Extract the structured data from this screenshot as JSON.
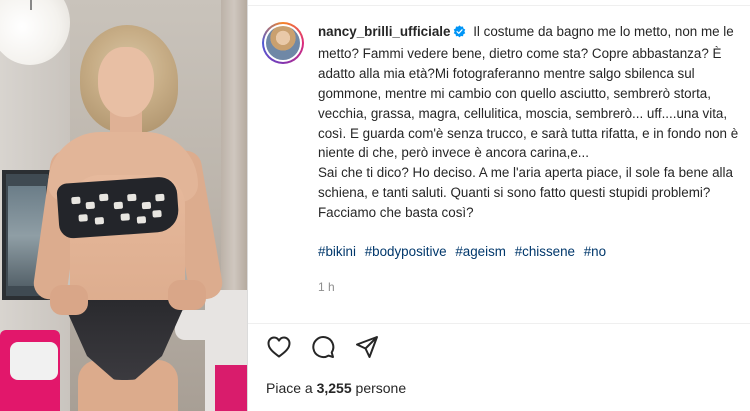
{
  "post": {
    "username": "nancy_brilli_ufficiale",
    "verified": true,
    "caption": "Il costume da bagno me lo metto, non me le metto? Fammi vedere bene, dietro come sta? Copre abbastanza? È adatto alla mia età?Mi fotograferanno mentre salgo sbilenca sul gommone, mentre mi cambio con quello asciutto, sembrerò storta, vecchia, grassa, magra, cellulitica, moscia, sembrerò... uff....una vita, così. E guarda com'è senza trucco, e sarà tutta rifatta, e in fondo non è niente di che, però invece è ancora carina,e...\nSai che ti dico? Ho deciso. A me l'aria aperta piace, il sole fa bene alla schiena, e tanti saluti. Quanti si sono fatto questi stupidi problemi?Facciamo che basta così?",
    "hashtags": [
      "#bikini",
      "#bodypositive",
      "#ageism",
      "#chissene",
      "#no"
    ],
    "time_ago": "1 h",
    "likes_prefix": "Piace a",
    "likes_count": "3,255",
    "likes_suffix": "persone"
  },
  "icons": {
    "like": "heart-icon",
    "comment": "comment-icon",
    "share": "share-icon",
    "verified": "verified-badge-icon"
  },
  "colors": {
    "text": "#262626",
    "hashtag": "#00376b",
    "muted": "#8e8e8e",
    "verified": "#0095f6"
  }
}
